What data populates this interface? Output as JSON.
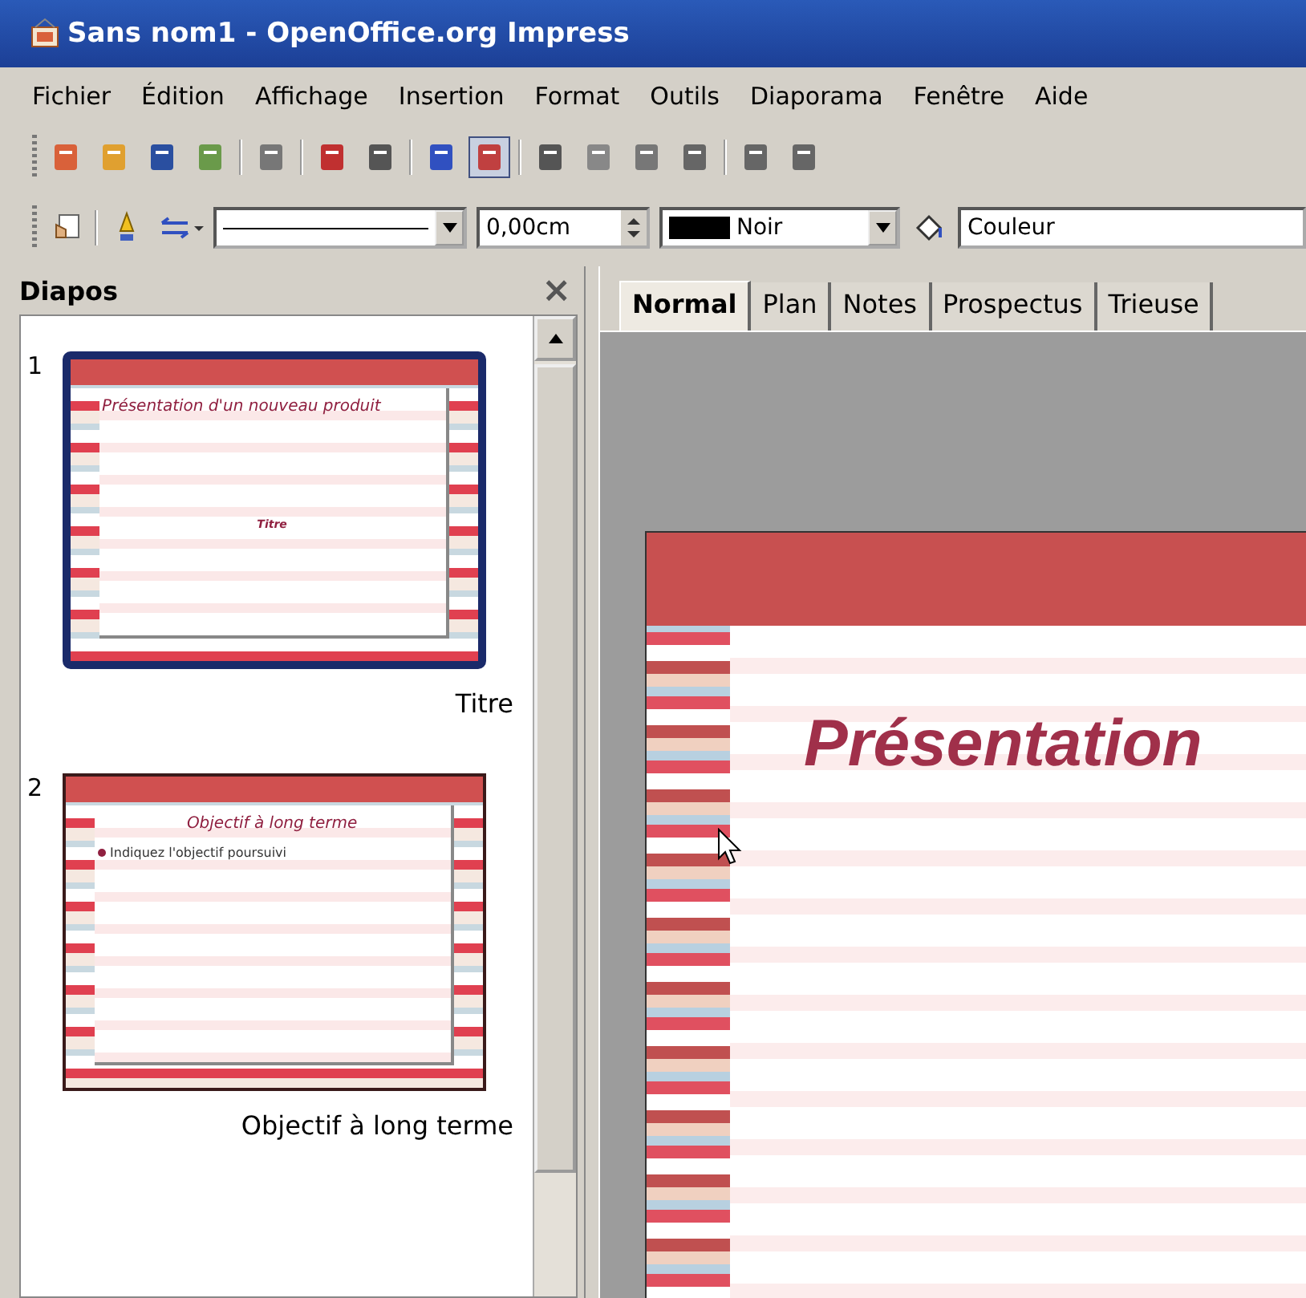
{
  "window": {
    "title": "Sans nom1 - OpenOffice.org Impress"
  },
  "menu": [
    "Fichier",
    "Édition",
    "Affichage",
    "Insertion",
    "Format",
    "Outils",
    "Diaporama",
    "Fenêtre",
    "Aide"
  ],
  "line_toolbar": {
    "width": "0,00cm",
    "line_color": "Noir",
    "fill": "Couleur"
  },
  "slides_panel": {
    "title": "Diapos",
    "close": "×",
    "slides": [
      {
        "number": "1",
        "label": "Titre",
        "selected": true,
        "thumb_title": "Présentation d'un nouveau produit",
        "thumb_text": "Titre",
        "kind": "title"
      },
      {
        "number": "2",
        "label": "Objectif à long terme",
        "selected": false,
        "thumb_title": "Objectif à long terme",
        "thumb_text": "Indiquez l'objectif poursuivi",
        "kind": "bullets"
      }
    ]
  },
  "tabs": [
    {
      "label": "Normal",
      "selected": true
    },
    {
      "label": "Plan",
      "selected": false
    },
    {
      "label": "Notes",
      "selected": false
    },
    {
      "label": "Prospectus",
      "selected": false
    },
    {
      "label": "Trieuse",
      "selected": false
    }
  ],
  "slide": {
    "title": "Présentation"
  }
}
